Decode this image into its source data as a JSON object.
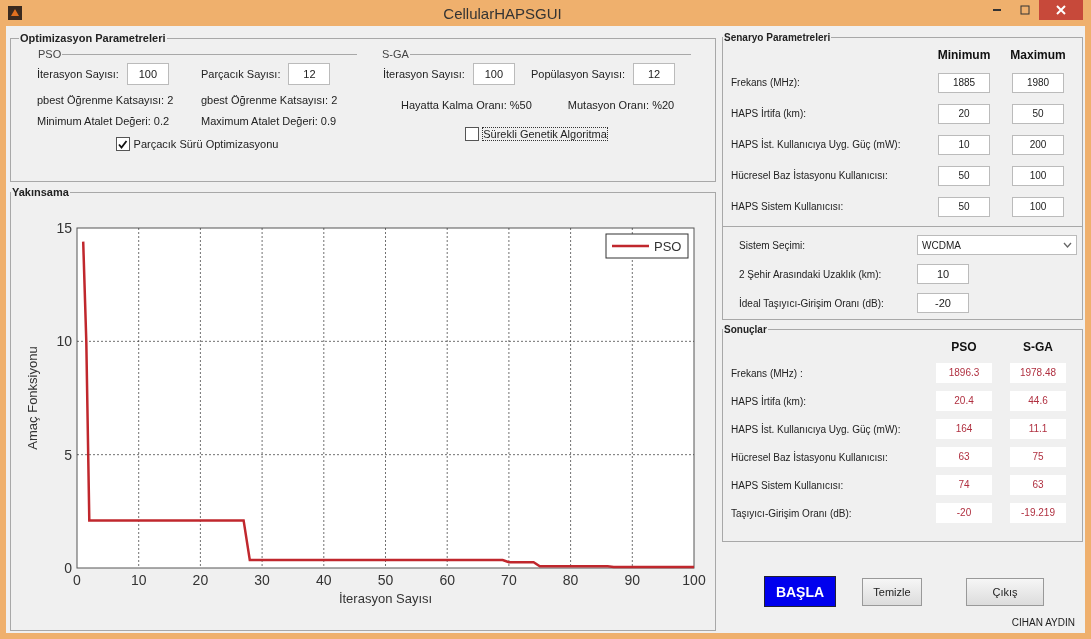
{
  "window": {
    "title": "CellularHAPSGUI"
  },
  "optimization": {
    "title": "Optimizasyon Parametreleri",
    "pso": {
      "title": "PSO",
      "fields": [
        {
          "label": "İterasyon Sayısı:",
          "value": "100"
        },
        {
          "label": "Parçacık Sayısı:",
          "value": "12"
        }
      ],
      "params": [
        "pbest Öğrenme Katsayısı: 2",
        "gbest Öğrenme Katsayısı: 2",
        "Minimum Atalet Değeri: 0.2",
        "Maximum Atalet Değeri: 0.9"
      ],
      "checkbox": {
        "label": "Parçacık Sürü Optimizasyonu",
        "checked": true
      }
    },
    "sga": {
      "title": "S-GA",
      "fields": [
        {
          "label": "İterasyon Sayısı:",
          "value": "100"
        },
        {
          "label": "Popülasyon Sayısı:",
          "value": "12"
        }
      ],
      "params": [
        "Hayatta Kalma Oranı: %50",
        "Mutasyon Oranı: %20"
      ],
      "checkbox": {
        "label": "Sürekli Genetik Algoritma",
        "checked": false,
        "focused": true
      }
    }
  },
  "convergence": {
    "title": "Yakınsama",
    "chart_data": {
      "type": "line",
      "xlabel": "İterasyon Sayısı",
      "ylabel": "Amaç Fonksiyonu",
      "xlim": [
        0,
        100
      ],
      "ylim": [
        0,
        15
      ],
      "xticks": [
        0,
        10,
        20,
        30,
        40,
        50,
        60,
        70,
        80,
        90,
        100
      ],
      "yticks": [
        0,
        5,
        10,
        15
      ],
      "grid": true,
      "x": [
        1,
        1.5,
        2,
        27,
        28,
        69,
        70,
        74,
        75,
        86,
        87,
        100
      ],
      "series": [
        {
          "name": "PSO",
          "color": "#c0272d",
          "values": [
            14.4,
            10,
            2.1,
            2.1,
            0.35,
            0.35,
            0.25,
            0.25,
            0.08,
            0.08,
            0.05,
            0.05
          ]
        }
      ]
    }
  },
  "scenario": {
    "title": "Senaryo Parametreleri",
    "columns": [
      "Minimum",
      "Maximum"
    ],
    "rows": [
      {
        "label": "Frekans (MHz):",
        "min": "1885",
        "max": "1980"
      },
      {
        "label": "HAPS İrtifa (km):",
        "min": "20",
        "max": "50"
      },
      {
        "label": "HAPS İst. Kullanıcıya Uyg. Güç (mW):",
        "min": "10",
        "max": "200"
      },
      {
        "label": "Hücresel Baz İstasyonu Kullanıcısı:",
        "min": "50",
        "max": "100"
      },
      {
        "label": "HAPS Sistem Kullanıcısı:",
        "min": "50",
        "max": "100"
      }
    ],
    "system": {
      "label": "Sistem Seçimi:",
      "value": "WCDMA"
    },
    "fields": [
      {
        "label": "2 Şehir Arasındaki Uzaklık (km):",
        "value": "10"
      },
      {
        "label": "İdeal Taşıyıcı-Girişim Oranı (dB):",
        "value": "-20"
      }
    ]
  },
  "results": {
    "title": "Sonuçlar",
    "columns": [
      "PSO",
      "S-GA"
    ],
    "rows": [
      {
        "label": "Frekans (MHz) :",
        "pso": "1896.3",
        "sga": "1978.48"
      },
      {
        "label": "HAPS İrtifa (km):",
        "pso": "20.4",
        "sga": "44.6"
      },
      {
        "label": "HAPS İst. Kullanıcıya Uyg. Güç (mW):",
        "pso": "164",
        "sga": "11.1"
      },
      {
        "label": "Hücresel Baz İstasyonu Kullanıcısı:",
        "pso": "63",
        "sga": "75"
      },
      {
        "label": "HAPS Sistem Kullanıcısı:",
        "pso": "74",
        "sga": "63"
      },
      {
        "label": "Taşıyıcı-Girişim Oranı (dB):",
        "pso": "-20",
        "sga": "-19.219"
      }
    ]
  },
  "buttons": [
    {
      "label": "BAŞLA",
      "kind": "primary"
    },
    {
      "label": "Temizle",
      "kind": "normal"
    },
    {
      "label": "Çıkış",
      "kind": "normal"
    }
  ],
  "author": "CIHAN AYDIN"
}
